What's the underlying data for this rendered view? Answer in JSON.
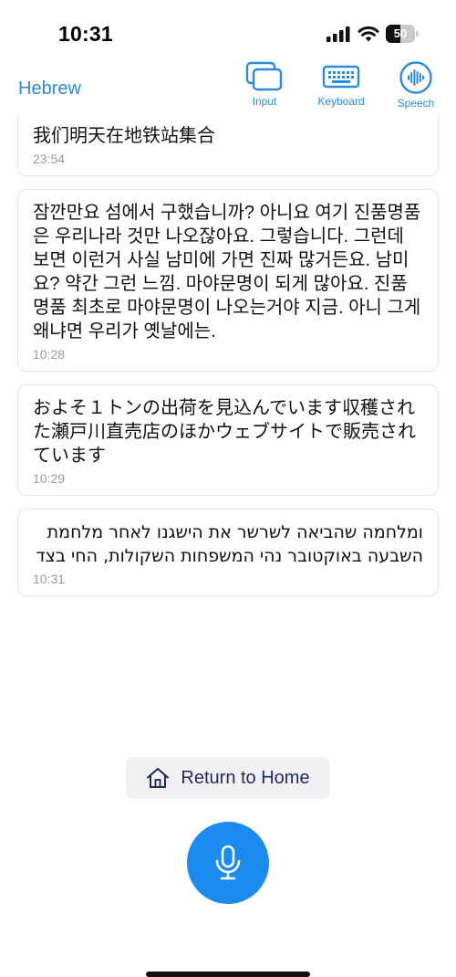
{
  "status_bar": {
    "time": "10:31",
    "battery_level": "50",
    "battery_percent": 50
  },
  "nav": {
    "language": "Hebrew",
    "actions": [
      {
        "id": "input",
        "label": "Input",
        "icon": "input-windows-icon"
      },
      {
        "id": "keyboard",
        "label": "Keyboard",
        "icon": "keyboard-icon"
      },
      {
        "id": "speech",
        "label": "Speech",
        "icon": "waveform-icon"
      }
    ]
  },
  "messages": [
    {
      "text": "我们明天在地铁站集合",
      "time": "23:54",
      "rtl": false
    },
    {
      "text": " 잠깐만요 섬에서 구했습니까? 아니요 여기 진품명품은 우리나라 것만 나오잖아요. 그렇습니다. 그런데 보면 이런거 사실 남미에 가면 진짜 많거든요. 남미요? 약간 그런 느낌. 마야문명이 되게 많아요. 진품명품 최초로 마야문명이 나오는거야 지금. 아니 그게 왜냐면 우리가 옛날에는.",
      "time": "10:28",
      "rtl": false
    },
    {
      "text": "およそ１トンの出荷を見込んでいます収穫された瀬戸川直売店のほかウェブサイトで販売されています",
      "time": "10:29",
      "rtl": false
    },
    {
      "text": "ומלחמה שהביאה לשרשר את הישגנו לאחר מלחמת השבעה באוקטובר נהי המשפחות השקולות, החי בצד",
      "time": "10:31",
      "rtl": true
    }
  ],
  "home_button": {
    "label": "Return to Home",
    "icon": "home-icon"
  },
  "mic_button": {
    "icon": "microphone-icon"
  },
  "colors": {
    "accent": "#2a8bd8",
    "mic_blue": "#1a8cf0",
    "home_text": "#1f2a5a",
    "timestamp": "#9a9a9f"
  }
}
